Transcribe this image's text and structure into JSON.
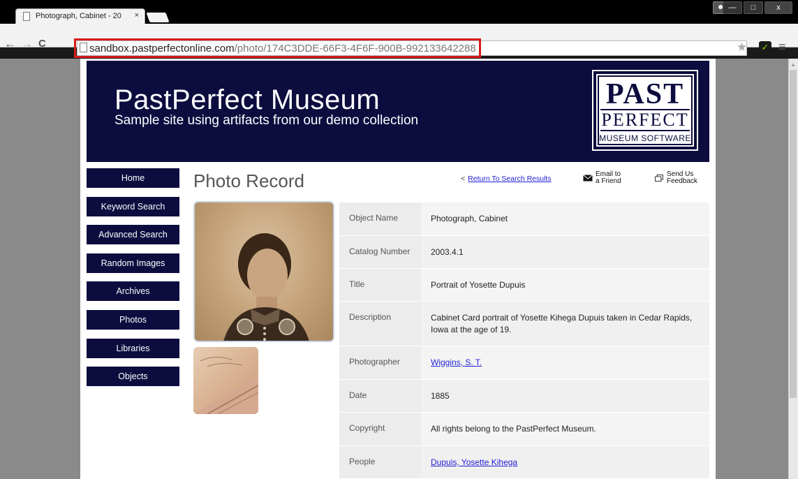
{
  "browser": {
    "tab_title": "Photograph, Cabinet - 20",
    "tab_close": "×",
    "url_domain": "sandbox.pastperfectonline.com",
    "url_path": "/photo/174C3DDE-66F3-4F6F-900B-992133642288",
    "back": "←",
    "forward": "→",
    "reload": "C",
    "star": "★",
    "menu": "≡",
    "ext": "✓",
    "minimize": "—",
    "maximize": "□",
    "close": "x"
  },
  "banner": {
    "title": "PastPerfect Museum",
    "subtitle": "Sample site using artifacts from our demo collection",
    "logo_line1": "PAST",
    "logo_line2": "PERFECT",
    "logo_line3": "MUSEUM SOFTWARE"
  },
  "nav": {
    "items": [
      "Home",
      "Keyword Search",
      "Advanced Search",
      "Random Images",
      "Archives",
      "Photos",
      "Libraries",
      "Objects"
    ]
  },
  "record": {
    "heading": "Photo Record",
    "return_link": "Return To Search Results",
    "email_line1": "Email to",
    "email_line2": "a Friend",
    "feedback_line1": "Send Us",
    "feedback_line2": "Feedback"
  },
  "fields": [
    {
      "label": "Object Name",
      "value": "Photograph, Cabinet"
    },
    {
      "label": "Catalog Number",
      "value": "2003.4.1"
    },
    {
      "label": "Title",
      "value": "Portrait of Yosette Dupuis"
    },
    {
      "label": "Description",
      "value": "Cabinet Card portrait of Yosette Kihega Dupuis taken in Cedar Rapids, Iowa at the age of 19."
    },
    {
      "label": "Photographer",
      "value": "Wiggins, S. T."
    },
    {
      "label": "Date",
      "value": "1885"
    },
    {
      "label": "Copyright",
      "value": "All rights belong to the PastPerfect Museum."
    },
    {
      "label": "People",
      "value": "Dupuis, Yosette Kihega"
    }
  ]
}
